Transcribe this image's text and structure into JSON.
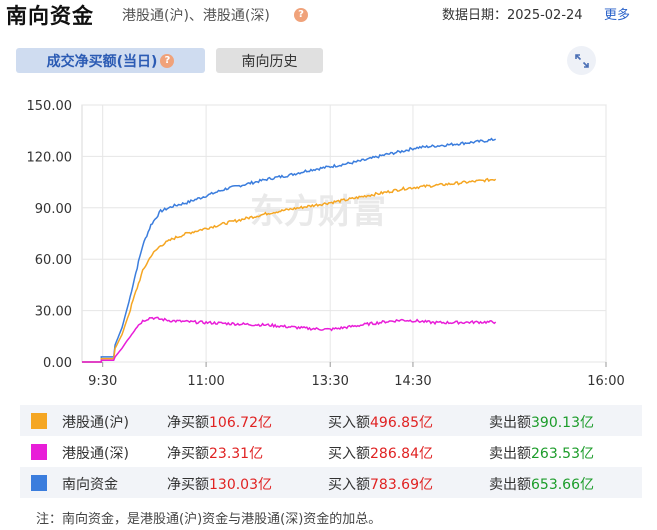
{
  "header": {
    "title": "南向资金",
    "subtitle": "港股通(沪)、港股通(深)",
    "help_icon": "?",
    "date_label": "数据日期：2025-02-24",
    "more_link": "更多"
  },
  "tabs": {
    "active": "成交净买额(当日)",
    "inactive": "南向历史",
    "help_icon": "?"
  },
  "watermark": "东方财富",
  "chart_data": {
    "type": "line",
    "x_ticks": [
      "9:30",
      "11:00",
      "13:30",
      "14:30",
      "16:00"
    ],
    "y_ticks": [
      "150.00",
      "120.00",
      "90.00",
      "60.00",
      "30.00",
      "0.00"
    ],
    "ylim": [
      0,
      150
    ],
    "grid": true,
    "series": [
      {
        "name": "南向资金",
        "color": "#3b7ddd",
        "values": [
          [
            0,
            0
          ],
          [
            14,
            0
          ],
          [
            14,
            3
          ],
          [
            23,
            3
          ],
          [
            24,
            10
          ],
          [
            29,
            20
          ],
          [
            34,
            35
          ],
          [
            39,
            52
          ],
          [
            44,
            68
          ],
          [
            50,
            80
          ],
          [
            57,
            88
          ],
          [
            66,
            91
          ],
          [
            76,
            93
          ],
          [
            90,
            97
          ],
          [
            104,
            101
          ],
          [
            120,
            104
          ],
          [
            136,
            107
          ],
          [
            150,
            109
          ],
          [
            165,
            112
          ],
          [
            180,
            114
          ],
          [
            194,
            116
          ],
          [
            206,
            118
          ],
          [
            220,
            121
          ],
          [
            232,
            123
          ],
          [
            242,
            125
          ],
          [
            255,
            126
          ],
          [
            268,
            127
          ],
          [
            280,
            128
          ],
          [
            292,
            129
          ],
          [
            300,
            130.03
          ]
        ]
      },
      {
        "name": "港股通(沪)",
        "color": "#f5a623",
        "values": [
          [
            0,
            0
          ],
          [
            14,
            0
          ],
          [
            14,
            2
          ],
          [
            23,
            2
          ],
          [
            24,
            8
          ],
          [
            29,
            16
          ],
          [
            34,
            28
          ],
          [
            39,
            41
          ],
          [
            44,
            53
          ],
          [
            50,
            62
          ],
          [
            57,
            68
          ],
          [
            66,
            72
          ],
          [
            76,
            75
          ],
          [
            90,
            78
          ],
          [
            104,
            81
          ],
          [
            120,
            84
          ],
          [
            136,
            87
          ],
          [
            150,
            89
          ],
          [
            165,
            91
          ],
          [
            180,
            93
          ],
          [
            194,
            95
          ],
          [
            206,
            97
          ],
          [
            220,
            99
          ],
          [
            232,
            101
          ],
          [
            242,
            102
          ],
          [
            255,
            103
          ],
          [
            268,
            104
          ],
          [
            280,
            105
          ],
          [
            292,
            106
          ],
          [
            300,
            106.72
          ]
        ]
      },
      {
        "name": "港股通(深)",
        "color": "#e81ed8",
        "values": [
          [
            0,
            0
          ],
          [
            14,
            0
          ],
          [
            14,
            1
          ],
          [
            23,
            1
          ],
          [
            24,
            3
          ],
          [
            29,
            8
          ],
          [
            34,
            14
          ],
          [
            39,
            20
          ],
          [
            44,
            24
          ],
          [
            50,
            26
          ],
          [
            57,
            25
          ],
          [
            66,
            24
          ],
          [
            76,
            23.5
          ],
          [
            90,
            23
          ],
          [
            104,
            22.5
          ],
          [
            120,
            22
          ],
          [
            136,
            21.5
          ],
          [
            150,
            20.5
          ],
          [
            165,
            19.5
          ],
          [
            180,
            19
          ],
          [
            194,
            20.5
          ],
          [
            206,
            22
          ],
          [
            220,
            23.5
          ],
          [
            232,
            24.5
          ],
          [
            242,
            24
          ],
          [
            255,
            23
          ],
          [
            268,
            23
          ],
          [
            280,
            23.2
          ],
          [
            292,
            23.3
          ],
          [
            300,
            23.31
          ]
        ]
      }
    ]
  },
  "legend": [
    {
      "name": "港股通(沪)",
      "color": "#f5a623",
      "net_label": "净买额",
      "net": "106.72亿",
      "buy_label": "买入额",
      "buy": "496.85亿",
      "sell_label": "卖出额",
      "sell": "390.13亿"
    },
    {
      "name": "港股通(深)",
      "color": "#e81ed8",
      "net_label": "净买额",
      "net": "23.31亿",
      "buy_label": "买入额",
      "buy": "286.84亿",
      "sell_label": "卖出额",
      "sell": "263.53亿"
    },
    {
      "name": "南向资金",
      "color": "#3b7ddd",
      "net_label": "净买额",
      "net": "130.03亿",
      "buy_label": "买入额",
      "buy": "783.69亿",
      "sell_label": "卖出额",
      "sell": "653.66亿"
    }
  ],
  "note": "注：南向资金，是港股通(沪)资金与港股通(深)资金的加总。"
}
